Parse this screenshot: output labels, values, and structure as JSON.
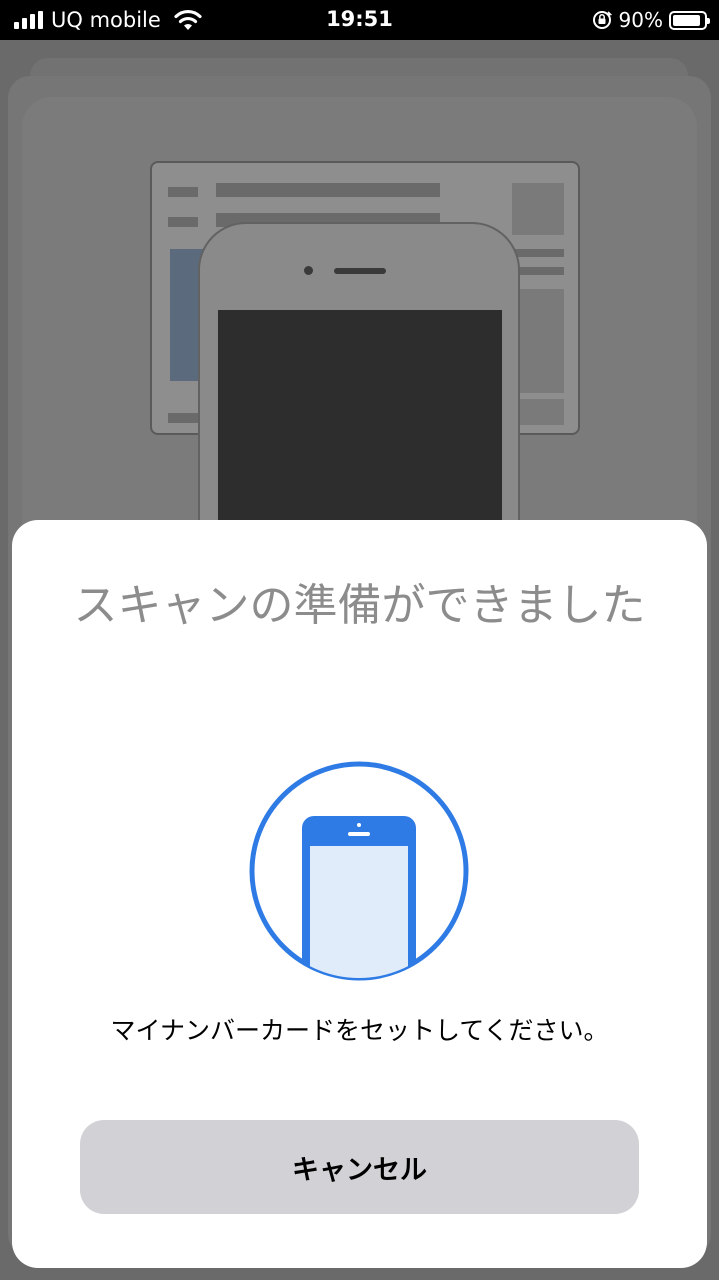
{
  "status_bar": {
    "carrier": "UQ mobile",
    "time": "19:51",
    "battery_percent": "90%",
    "battery_level": 0.9,
    "icons": [
      "signal-icon",
      "wifi-icon",
      "orientation-lock-icon",
      "battery-icon"
    ]
  },
  "sheet": {
    "title": "スキャンの準備ができました",
    "instruction": "マイナンバーカードをセットしてください。",
    "cancel_label": "キャンセル",
    "illustration_icon": "phone-icon"
  },
  "colors": {
    "accent": "#2f7be5",
    "title_gray": "#8c8c8c",
    "button_bg": "#d1d1d6",
    "dim_overlay": "#6a6a6a"
  }
}
